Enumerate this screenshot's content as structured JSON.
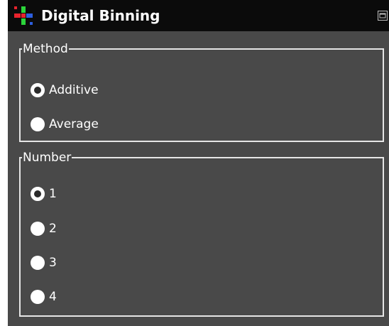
{
  "window": {
    "title": "Digital Binning",
    "app_icon": "plus-grid-icon",
    "restore_icon": "restore-icon"
  },
  "method": {
    "legend": "Method",
    "options": [
      {
        "label": "Additive",
        "selected": true
      },
      {
        "label": "Average",
        "selected": false
      }
    ]
  },
  "number": {
    "legend": "Number",
    "options": [
      {
        "label": "1",
        "selected": true
      },
      {
        "label": "2",
        "selected": false
      },
      {
        "label": "3",
        "selected": false
      },
      {
        "label": "4",
        "selected": false
      }
    ]
  },
  "colors": {
    "panel_background": "#494949",
    "titlebar_background": "#0b0b0b",
    "icon_red": "#e8232d",
    "icon_green": "#2bd43a",
    "icon_blue": "#2d5fe0",
    "text": "#ffffff"
  }
}
